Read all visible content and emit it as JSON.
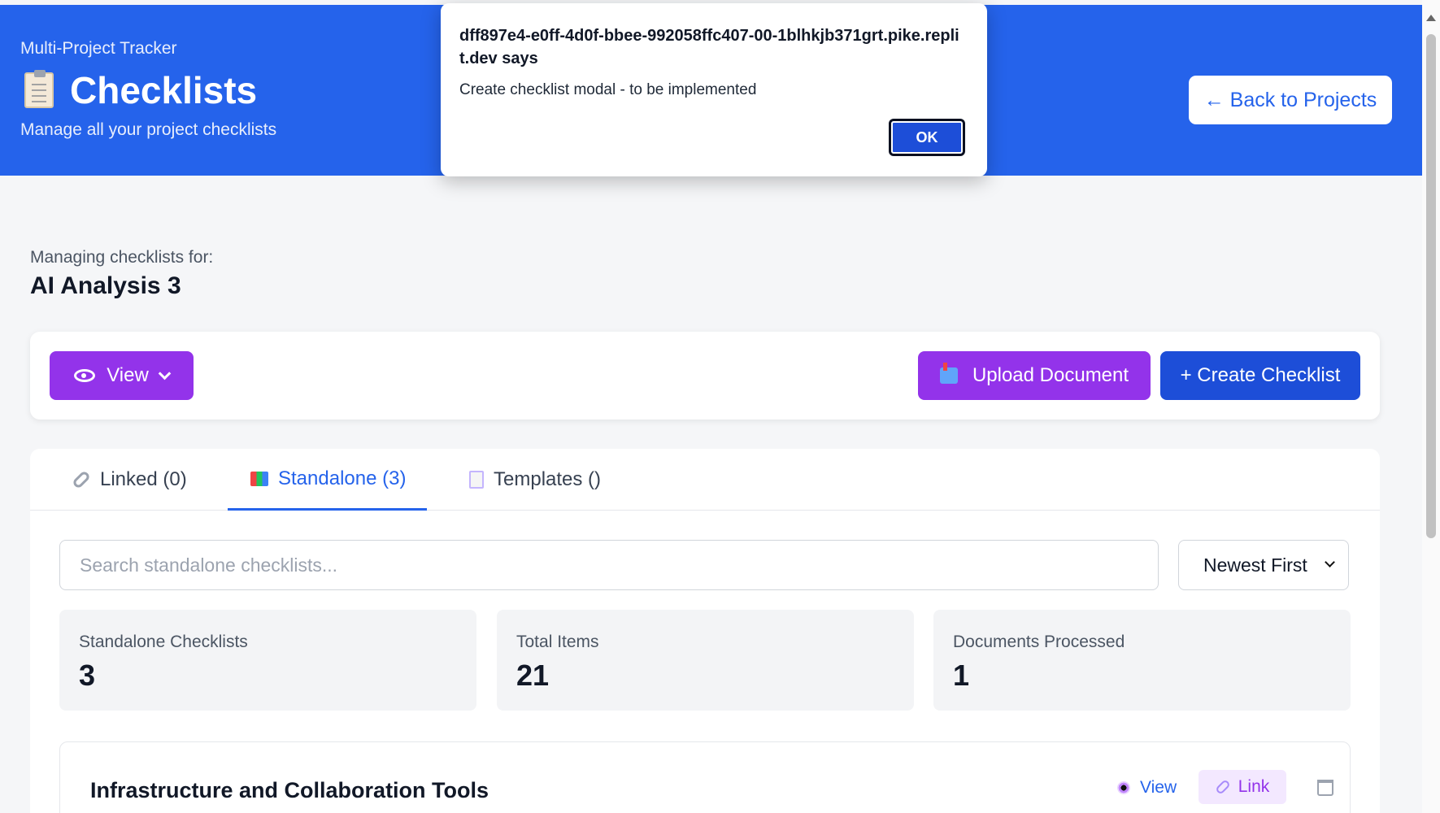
{
  "header": {
    "app_name": "Multi-Project Tracker",
    "title": "Checklists",
    "subtitle": "Manage all your project checklists",
    "back_button": "← Back to Projects",
    "background": "#2563eb"
  },
  "project": {
    "label": "Managing checklists for:",
    "name": "AI Analysis 3"
  },
  "toolbar": {
    "view_label": "View",
    "upload_label": "Upload Document",
    "create_label": "+ Create Checklist",
    "accent_purple": "#9333ea",
    "accent_blue": "#1d4ed8"
  },
  "tabs": [
    {
      "label": "Linked (0)",
      "icon": "link-icon",
      "active": false
    },
    {
      "label": "Standalone (3)",
      "icon": "books-icon",
      "active": true
    },
    {
      "label": "Templates ()",
      "icon": "document-icon",
      "active": false
    }
  ],
  "search": {
    "placeholder": "Search standalone checklists...",
    "value": ""
  },
  "sort": {
    "selected": "Newest First"
  },
  "stats": [
    {
      "label": "Standalone Checklists",
      "value": "3"
    },
    {
      "label": "Total Items",
      "value": "21"
    },
    {
      "label": "Documents Processed",
      "value": "1"
    }
  ],
  "checklists": [
    {
      "title": "Infrastructure and Collaboration Tools",
      "view_label": "View",
      "link_label": "Link"
    }
  ],
  "dialog": {
    "origin": "dff897e4-e0ff-4d0f-bbee-992058ffc407-00-1blhkjb371grt.pike.replit.dev says",
    "message": "Create checklist modal - to be implemented",
    "ok_label": "OK"
  }
}
